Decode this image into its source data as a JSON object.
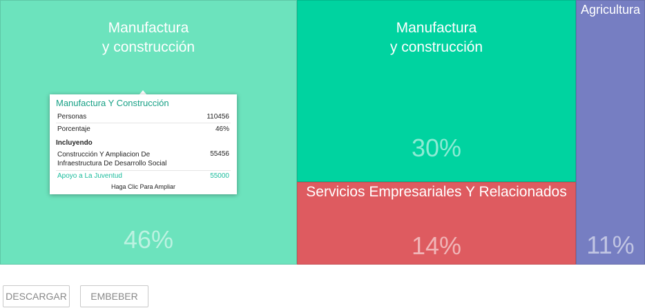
{
  "chart_data": {
    "type": "treemap",
    "cells": [
      {
        "id": "mfg-1",
        "label": "Manufactura\ny construcción",
        "percent": 46,
        "percent_label": "46%",
        "color": "#6ce3bd"
      },
      {
        "id": "mfg-2",
        "label": "Manufactura\ny construcción",
        "percent": 30,
        "percent_label": "30%",
        "color": "#00d3a0"
      },
      {
        "id": "services",
        "label": "Servicios Empresariales Y Relacionados",
        "percent": 14,
        "percent_label": "14%",
        "color": "#de5b60"
      },
      {
        "id": "agri",
        "label": "Agricultura",
        "percent": 11,
        "percent_label": "11%",
        "color": "#767ec2"
      }
    ]
  },
  "tooltip": {
    "title": "Manufactura Y Construcción",
    "rows": [
      {
        "label": "Personas",
        "value": "110456"
      },
      {
        "label": "Porcentaje",
        "value": "46%"
      }
    ],
    "section_title": "Incluyendo",
    "sub_rows": [
      {
        "label": "Construcción Y Ampliacion De Infraestructura De Desarrollo Social",
        "value": "55456"
      },
      {
        "label": "Apoyo a La Juventud",
        "value": "55000"
      }
    ],
    "footer": "Haga Clic Para Ampliar"
  },
  "buttons": {
    "download": "DESCARGAR",
    "embed": "EMBEBER"
  }
}
